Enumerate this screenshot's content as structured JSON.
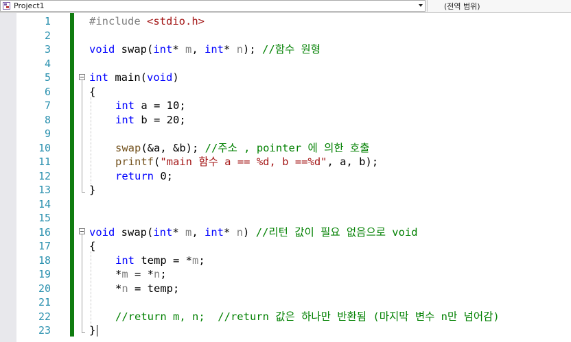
{
  "navigation": {
    "project_label": "Project1",
    "scope_label": "(전역 범위)"
  },
  "editor": {
    "line_numbers": [
      "1",
      "2",
      "3",
      "4",
      "5",
      "6",
      "7",
      "8",
      "9",
      "10",
      "11",
      "12",
      "13",
      "14",
      "15",
      "16",
      "17",
      "18",
      "19",
      "20",
      "21",
      "22",
      "23"
    ],
    "lines": {
      "l1_pp": "#include ",
      "l1_str": "<stdio.h>",
      "l3_a": "void",
      "l3_b": " swap(",
      "l3_c": "int",
      "l3_d": "* ",
      "l3_e": "m",
      "l3_f": ", ",
      "l3_g": "int",
      "l3_h": "* ",
      "l3_i": "n",
      "l3_j": "); ",
      "l3_cm": "//함수 원형",
      "l5_a": "int",
      "l5_b": " main(",
      "l5_c": "void",
      "l5_d": ")",
      "l6": "{",
      "l7_a": "int",
      "l7_b": " a = 10;",
      "l8_a": "int",
      "l8_b": " b = 20;",
      "l10_a": "swap",
      "l10_b": "(&a, &b); ",
      "l10_cm": "//주소 , pointer 에 의한 호출",
      "l11_a": "printf",
      "l11_b": "(",
      "l11_str": "\"main 함수 a == %d, b ==%d\"",
      "l11_c": ", a, b);",
      "l12_a": "return",
      "l12_b": " 0;",
      "l13": "}",
      "l16_a": "void",
      "l16_b": " swap(",
      "l16_c": "int",
      "l16_d": "* ",
      "l16_e": "m",
      "l16_f": ", ",
      "l16_g": "int",
      "l16_h": "* ",
      "l16_i": "n",
      "l16_j": ") ",
      "l16_cm": "//리턴 값이 필요 없음으로 void",
      "l17": "{",
      "l18_a": "int",
      "l18_b": " temp = *",
      "l18_c": "m",
      "l18_d": ";",
      "l19_a": "*",
      "l19_b": "m",
      "l19_c": " = *",
      "l19_d": "n",
      "l19_e": ";",
      "l20_a": "*",
      "l20_b": "n",
      "l20_c": " = temp;",
      "l22_cm": "//return m, n;  //return 값은 하나만 반환됨 (마지막 변수 n만 넘어감)",
      "l23": "}"
    }
  },
  "colors": {
    "keyword": "#0000ff",
    "preprocessor": "#808080",
    "string": "#a31515",
    "comment": "#008000",
    "function": "#74531f",
    "line_number": "#2b91af",
    "change_bar": "#107c10"
  }
}
